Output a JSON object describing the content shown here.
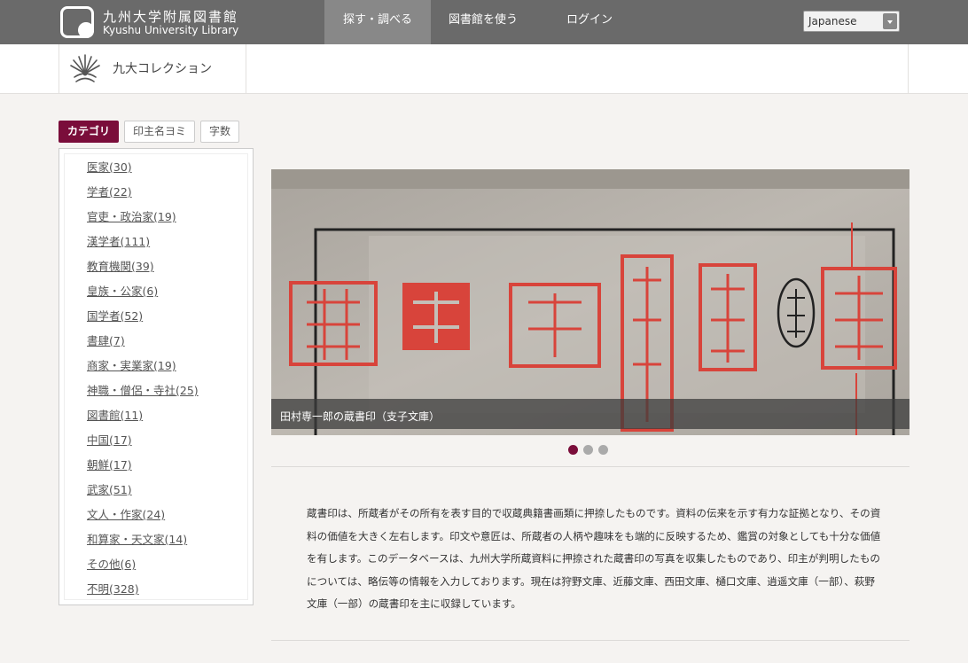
{
  "header": {
    "logo_ja": "九州大学附属図書館",
    "logo_en": "Kyushu University Library",
    "nav": [
      {
        "label": "探す・調べる",
        "active": true
      },
      {
        "label": "図書館を使う",
        "active": false
      },
      {
        "label": "ログイン",
        "active": false
      }
    ],
    "language": "Japanese"
  },
  "subheader": {
    "title": "九大コレクション"
  },
  "tabs": [
    {
      "label": "カテゴリ",
      "active": true
    },
    {
      "label": "印主名ヨミ",
      "active": false
    },
    {
      "label": "字数",
      "active": false
    }
  ],
  "categories": [
    "医家(30)",
    "学者(22)",
    "官吏・政治家(19)",
    "漢学者(111)",
    "教育機関(39)",
    "皇族・公家(6)",
    "国学者(52)",
    "書肆(7)",
    "商家・実業家(19)",
    "神職・僧侶・寺社(25)",
    "図書館(11)",
    "中国(17)",
    "朝鮮(17)",
    "武家(51)",
    "文人・作家(24)",
    "和算家・天文家(14)",
    "その他(6)",
    "不明(328)"
  ],
  "slideshow": {
    "caption": "田村専一郎の蔵書印（支子文庫）",
    "dots": 3,
    "active_index": 0
  },
  "description": "蔵書印は、所蔵者がその所有を表す目的で収蔵典籍書画類に押捺したものです。資料の伝来を示す有力な証拠となり、その資料の価値を大きく左右します。印文や意匠は、所蔵者の人柄や趣味をも端的に反映するため、鑑賞の対象としても十分な価値を有します。このデータベースは、九州大学所蔵資料に押捺された蔵書印の写真を収集したものであり、印主が判明したものについては、略伝等の情報を入力しております。現在は狩野文庫、近藤文庫、西田文庫、樋口文庫、逍遥文庫（一部）、萩野文庫（一部）の蔵書印を主に収録しています。",
  "colors": {
    "accent": "#7a0d3a",
    "topbar": "#6a6a6a",
    "seal_red": "#d8443b"
  }
}
